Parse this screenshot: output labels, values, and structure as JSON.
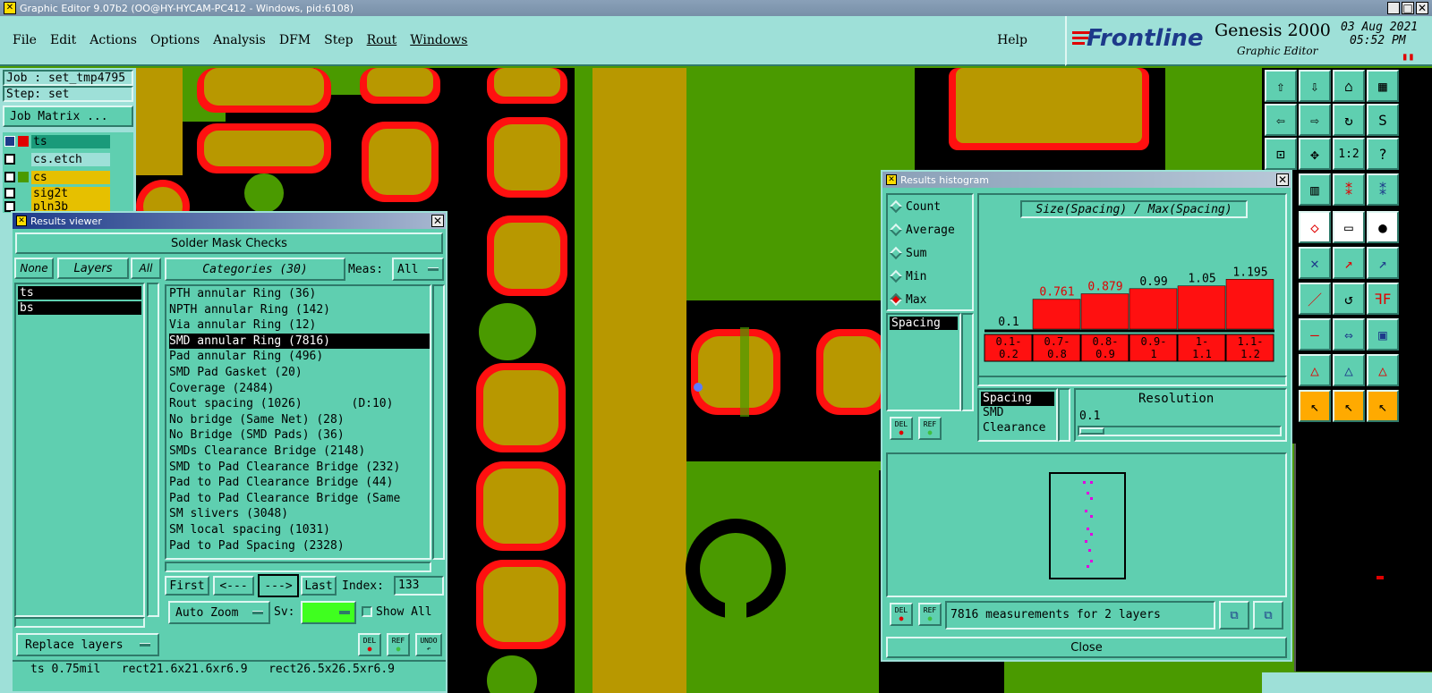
{
  "window": {
    "title": "Graphic Editor 9.07b2 (OO@HY-HYCAM-PC412 - Windows, pid:6108)"
  },
  "menu": {
    "items": [
      "File",
      "Edit",
      "Actions",
      "Options",
      "Analysis",
      "DFM",
      "Step",
      "Rout",
      "Windows"
    ],
    "help": "Help"
  },
  "header": {
    "brand": "Frontline",
    "product": "Genesis 2000",
    "subtitle": "Graphic Editor",
    "date": "03 Aug 2021",
    "time": "05:52 PM"
  },
  "job": {
    "job_label": "Job : set_tmp4795",
    "step_label": "Step: set",
    "matrix_button": "Job Matrix ..."
  },
  "layers": [
    {
      "name": "ts",
      "color": "#1a9a7a"
    },
    {
      "name": "cs.etch",
      "color": "#9ee0d8"
    },
    {
      "name": "cs",
      "color": "#e6c000"
    },
    {
      "name": "sig2t",
      "color": "#e6c000"
    },
    {
      "name": "pln3b",
      "color": "#e6c000"
    }
  ],
  "results_viewer": {
    "title": "Results viewer",
    "header": "Solder Mask Checks",
    "none_btn": "None",
    "layers_btn": "Layers",
    "all_btn": "All",
    "categories_btn": "Categories (30)",
    "meas_label": "Meas:",
    "meas_value": "All",
    "layer_list": [
      "ts",
      "bs"
    ],
    "categories": [
      "PTH annular Ring (36)",
      "NPTH annular Ring (142)",
      "Via annular Ring (12)",
      "SMD annular Ring (7816)",
      "Pad annular Ring (496)",
      "SMD Pad Gasket (20)",
      "Coverage (2484)",
      "Rout spacing (1026)       (D:10)",
      "No bridge (Same Net) (28)",
      "No Bridge (SMD Pads) (36)",
      "SMDs Clearance Bridge (2148)",
      "SMD to Pad Clearance Bridge (232)",
      "Pad to Pad Clearance Bridge (44)",
      "Pad to Pad Clearance Bridge (Same",
      "SM slivers (3048)",
      "SM local spacing (1031)",
      "Pad to Pad Spacing (2328)"
    ],
    "selected_category": 3,
    "first_btn": "First",
    "prev_btn": "<---",
    "next_btn": "--->",
    "last_btn": "Last",
    "index_label": "Index:",
    "index_value": "133",
    "zoom_option": "Auto Zoom",
    "sv_label": "Sv:",
    "show_all_label": "Show All",
    "replace_btn": "Replace layers",
    "del_btn": "DEL",
    "ref_btn": "REF",
    "undo_btn": "UNDO",
    "status": "ts 0.75mil   rect21.6x21.6xr6.9   rect26.5x26.5xr6.9"
  },
  "histogram": {
    "title": "Results histogram",
    "modes": [
      "Count",
      "Average",
      "Sum",
      "Min",
      "Max"
    ],
    "selected_mode": 4,
    "spacing_list": [
      "Spacing"
    ],
    "chart_title": "Size(Spacing) / Max(Spacing)",
    "meas_types": [
      "Spacing",
      "SMD",
      "Clearance"
    ],
    "resolution_label": "Resolution",
    "resolution_value": "0.1",
    "measurements_text": "7816 measurements for 2 layers",
    "close_btn": "Close",
    "del_btn": "DEL",
    "ref_btn": "REF"
  },
  "chart_data": {
    "type": "bar",
    "title": "Size(Spacing) / Max(Spacing)",
    "categories": [
      "",
      "0.1-\n0.2",
      "0.7-\n0.8",
      "0.8-\n0.9",
      "0.9-\n1",
      "1-\n1.1",
      "1.1-\n1.2"
    ],
    "values": [
      0.1,
      0.761,
      0.879,
      0.99,
      1.05,
      1.195
    ],
    "value_labels": [
      "0.1",
      "0.761",
      "0.879",
      "0.99",
      "1.05",
      "1.195"
    ],
    "bin_labels": [
      [
        "0.1-",
        "0.2"
      ],
      [
        "0.7-",
        "0.8"
      ],
      [
        "0.8-",
        "0.9"
      ],
      [
        "0.9-",
        "1"
      ],
      [
        "1-",
        "1.1"
      ],
      [
        "1.1-",
        "1.2"
      ]
    ],
    "label_colors": [
      "#000000",
      "#e00000",
      "#e00000",
      "#000000",
      "#000000",
      "#000000"
    ],
    "ylim": [
      0,
      1.2
    ]
  },
  "colors": {
    "copper": "#b89800",
    "mask": "#ff1010",
    "board": "#4a9a00",
    "panel": "#5fcfb0"
  }
}
